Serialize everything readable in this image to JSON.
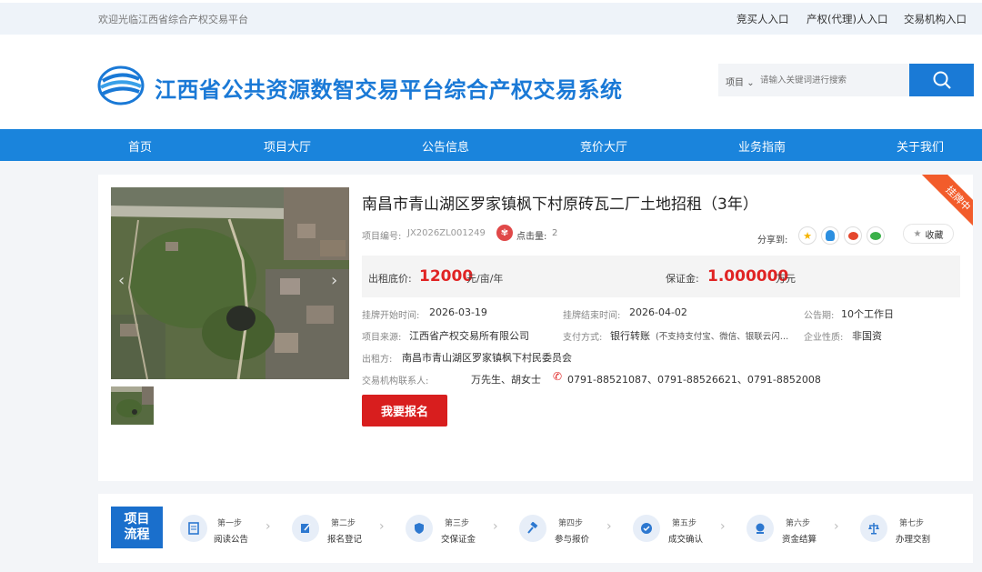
{
  "topbar": {
    "welcome": "欢迎光临江西省综合产权交易平台",
    "links": [
      "竞买人入口",
      "产权(代理)人入口",
      "交易机构入口"
    ]
  },
  "header": {
    "site_title": "江西省公共资源数智交易平台综合产权交易系统",
    "search_select": "项目",
    "search_placeholder": "请输入关键词进行搜索"
  },
  "nav": [
    "首页",
    "项目大厅",
    "公告信息",
    "竞价大厅",
    "业务指南",
    "关于我们"
  ],
  "project": {
    "status_ribbon": "挂牌中",
    "title": "南昌市青山湖区罗家镇枫下村原砖瓦二厂土地招租（3年）",
    "code_label": "项目编号:",
    "code": "JX2026ZL001249",
    "clicks_label": "点击量:",
    "clicks": "2",
    "share_label": "分享到:",
    "fav_label": "收藏",
    "rent_label": "出租底价:",
    "rent_value": "12000",
    "rent_unit": "元/亩/年",
    "deposit_label": "保证金:",
    "deposit_value": "1.000000",
    "deposit_unit": "万元",
    "start_label": "挂牌开始时间:",
    "start": "2026-03-19",
    "end_label": "挂牌结束时间:",
    "end": "2026-04-02",
    "period_label": "公告期:",
    "period": "10个工作日",
    "source_label": "项目来源:",
    "source": "江西省产权交易所有限公司",
    "pay_label": "支付方式:",
    "pay": "银行转账",
    "pay_note": "(不支持支付宝、微信、银联云闪…",
    "nature_label": "企业性质:",
    "nature": "非国资",
    "lessor_label": "出租方:",
    "lessor": "南昌市青山湖区罗家镇枫下村民委员会",
    "contact_label": "交易机构联系人:",
    "contact": "万先生、胡女士",
    "phone": "0791-88521087、0791-88526621、0791-8852008",
    "signup_label": "我要报名"
  },
  "process": {
    "label_line1": "项目",
    "label_line2": "流程",
    "steps": [
      {
        "top": "第一步",
        "bottom": "阅读公告",
        "icon": "document-icon"
      },
      {
        "top": "第二步",
        "bottom": "报名登记",
        "icon": "edit-icon"
      },
      {
        "top": "第三步",
        "bottom": "交保证金",
        "icon": "shield-icon"
      },
      {
        "top": "第四步",
        "bottom": "参与报价",
        "icon": "gavel-icon"
      },
      {
        "top": "第五步",
        "bottom": "成交确认",
        "icon": "check-icon"
      },
      {
        "top": "第六步",
        "bottom": "资金结算",
        "icon": "money-icon"
      },
      {
        "top": "第七步",
        "bottom": "办理交割",
        "icon": "scale-icon"
      }
    ]
  },
  "colors": {
    "brand_blue": "#1a84dc",
    "title_blue": "#1a79d6",
    "price_red": "#e02424",
    "button_red": "#d81e1e",
    "ribbon_orange": "#f25c2b"
  }
}
